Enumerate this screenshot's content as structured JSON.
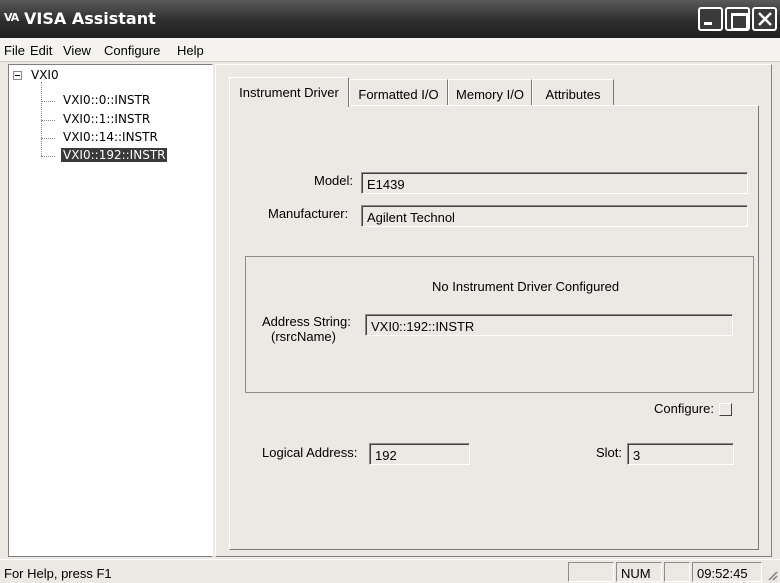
{
  "window": {
    "logo_text": "VA",
    "title": "VISA Assistant"
  },
  "menu": [
    "File",
    "Edit",
    "View",
    "Configure",
    "Help"
  ],
  "tree": {
    "root": "VXI0",
    "children": [
      "VXI0::0::INSTR",
      "VXI0::1::INSTR",
      "VXI0::14::INSTR",
      "VXI0::192::INSTR"
    ],
    "selected": "VXI0::192::INSTR"
  },
  "tabs": [
    "Instrument Driver",
    "Formatted I/O",
    "Memory I/O",
    "Attributes"
  ],
  "active_tab": "Instrument Driver",
  "form": {
    "model_label": "Model:",
    "model_value": "E1439",
    "manufacturer_label": "Manufacturer:",
    "manufacturer_value": "Agilent Technol",
    "driver_status": "No Instrument Driver Configured",
    "address_label_line1": "Address String:",
    "address_label_line2": "(rsrcName)",
    "address_value": "VXI0::192::INSTR",
    "configure_label": "Configure:",
    "configure_checked": false,
    "logical_address_label": "Logical Address:",
    "logical_address_value": "192",
    "slot_label": "Slot:",
    "slot_value": "3"
  },
  "status": {
    "help_text": "For Help, press F1",
    "num": "NUM",
    "time": "09:52:45"
  }
}
